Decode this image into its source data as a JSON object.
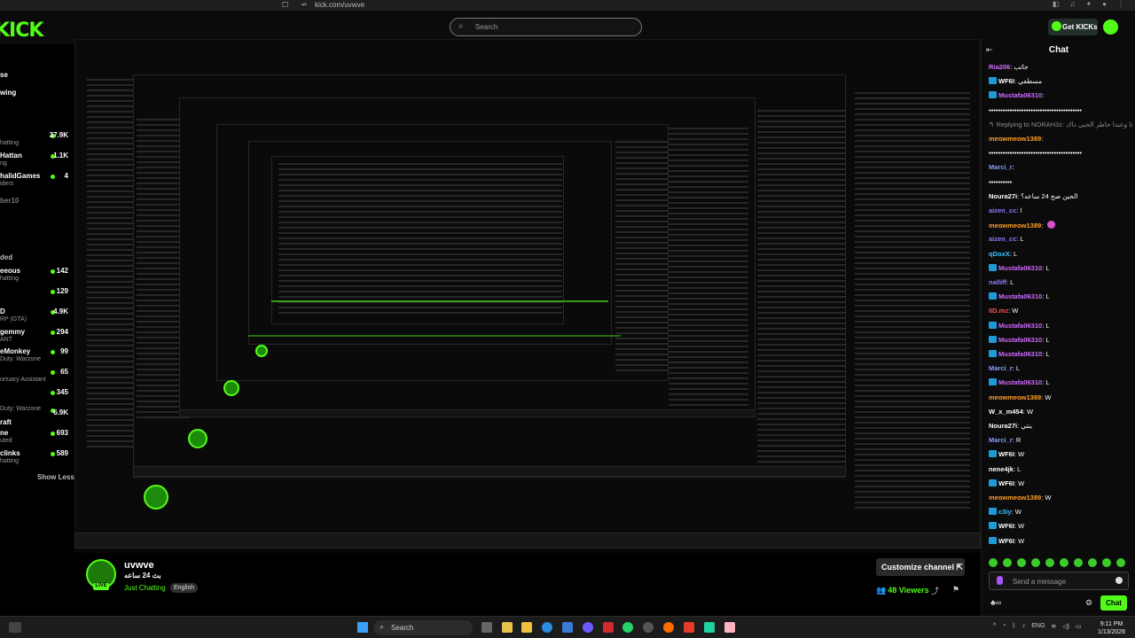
{
  "browser": {
    "url": "kick.com/uvwve"
  },
  "header": {
    "logo": "KICK",
    "search_placeholder": "Search",
    "get_kicks": "Get KICKs"
  },
  "sidebar": {
    "nav": [
      "se",
      "wing"
    ],
    "following": [
      {
        "name": "",
        "sub": "hatting",
        "viewers": "37.9K"
      },
      {
        "name": "Hattan",
        "sub": "ng",
        "viewers": "1.1K"
      },
      {
        "name": "halidGames",
        "sub": "iders",
        "viewers": "4"
      },
      {
        "name": "ber10",
        "sub": "",
        "viewers": ""
      }
    ],
    "recommended_label": "ded",
    "recommended": [
      {
        "name": "eeous",
        "sub": "hatting",
        "viewers": "142"
      },
      {
        "name": "",
        "sub": "",
        "viewers": "129"
      },
      {
        "name": "D",
        "sub": "RP (GTA)",
        "viewers": "4.9K"
      },
      {
        "name": "gemmy",
        "sub": "ANT",
        "viewers": "294"
      },
      {
        "name": "eMonkey",
        "sub": "Duty: Warzone",
        "viewers": "99"
      },
      {
        "name": "",
        "sub": "ortuary Assistant",
        "viewers": "65"
      },
      {
        "name": "",
        "sub": "",
        "viewers": "345"
      },
      {
        "name": "",
        "sub": "Duty: Warzone",
        "viewers": "6.9K"
      },
      {
        "name": "raft",
        "sub": "",
        "viewers": ""
      },
      {
        "name": "ne",
        "sub": "uted",
        "viewers": "693"
      },
      {
        "name": "clinks",
        "sub": "hatting",
        "viewers": "589"
      }
    ],
    "show_less": "Show Less"
  },
  "stream": {
    "name": "uvwve",
    "title": "بث 24 ساعه",
    "category": "Just Chatting",
    "language": "English",
    "live": "LIVE",
    "customize": "Customize channel",
    "viewers": "48 Viewers"
  },
  "chat": {
    "title": "Chat",
    "messages": [
      {
        "user": "Ria206",
        "text": "جاتب",
        "color": "#d56cff",
        "badge": false
      },
      {
        "user": "WF6I",
        "text": "مسطفي",
        "color": "#ffffff",
        "badge": true
      },
      {
        "user": "Mustafa06310",
        "text": "",
        "color": "#cf6bff",
        "badge": true
      },
      {
        "user": "",
        "text": "••••••••••••••••••••••••••••••••••••••••",
        "color": "#fff",
        "badge": false
      },
      {
        "user": "",
        "text": "↰ Replying to NORAH3z: راعيت لولاقا وعندا خاطر الحبي داك",
        "color": "#8c8c8c",
        "badge": false
      },
      {
        "user": "meowmeow1389",
        "text": "",
        "color": "#ff9e2c",
        "badge": false
      },
      {
        "user": "",
        "text": "••••••••••••••••••••••••••••••••••••••••",
        "color": "#fff",
        "badge": false
      },
      {
        "user": "Marci_r",
        "text": "",
        "color": "#7fa0ff",
        "badge": false
      },
      {
        "user": "",
        "text": "••••••••••",
        "color": "#fff",
        "badge": false
      },
      {
        "user": "Noura27i",
        "text": "الحين صح 24 ساعه؟",
        "color": "#ffffff",
        "badge": false
      },
      {
        "user": "aizen_cc",
        "text": "l",
        "color": "#8a78ff",
        "badge": false
      },
      {
        "user": "meowmeow1389",
        "text": "",
        "color": "#ff9e2c",
        "badge": false,
        "emote": true
      },
      {
        "user": "aizen_cc",
        "text": "L",
        "color": "#8a78ff",
        "badge": false
      },
      {
        "user": "qDoxX",
        "text": "L",
        "color": "#3bc3ff",
        "badge": false
      },
      {
        "user": "Mustafa06310",
        "text": "L",
        "color": "#cf6bff",
        "badge": true
      },
      {
        "user": "nalliff",
        "text": "L",
        "color": "#8f7cff",
        "badge": false
      },
      {
        "user": "Mustafa06310",
        "text": "L",
        "color": "#cf6bff",
        "badge": true
      },
      {
        "user": "0D.mz",
        "text": "W",
        "color": "#ff4d4d",
        "badge": false
      },
      {
        "user": "Mustafa06310",
        "text": "L",
        "color": "#cf6bff",
        "badge": true
      },
      {
        "user": "Mustafa06310",
        "text": "L",
        "color": "#cf6bff",
        "badge": true
      },
      {
        "user": "Mustafa06310",
        "text": "L",
        "color": "#cf6bff",
        "badge": true
      },
      {
        "user": "Marci_r",
        "text": "L",
        "color": "#7fa0ff",
        "badge": false
      },
      {
        "user": "Mustafa06310",
        "text": "L",
        "color": "#cf6bff",
        "badge": true
      },
      {
        "user": "meowmeow1389",
        "text": "W",
        "color": "#ff9e2c",
        "badge": false
      },
      {
        "user": "W_x_m454",
        "text": "W",
        "color": "#ffffff",
        "badge": false
      },
      {
        "user": "Noura27i",
        "text": "بنتي",
        "color": "#ffffff",
        "badge": false
      },
      {
        "user": "Marci_r",
        "text": "R",
        "color": "#7fa0ff",
        "badge": false
      },
      {
        "user": "WF6I",
        "text": "W",
        "color": "#ffffff",
        "badge": true
      },
      {
        "user": "nene4jk",
        "text": "L",
        "color": "#ffffff",
        "badge": false
      },
      {
        "user": "WF6I",
        "text": "W",
        "color": "#ffffff",
        "badge": true
      },
      {
        "user": "meowmeow1389",
        "text": "W",
        "color": "#ff9e2c",
        "badge": false
      },
      {
        "user": "c3iy",
        "text": "W",
        "color": "#3bc3ff",
        "badge": true
      },
      {
        "user": "WF6I",
        "text": "W",
        "color": "#ffffff",
        "badge": true
      },
      {
        "user": "WF6I",
        "text": "W",
        "color": "#ffffff",
        "badge": true
      }
    ],
    "input_placeholder": "Send a message",
    "send": "Chat"
  },
  "taskbar": {
    "search": "Search",
    "lang": "ENG",
    "time": "9:11 PM",
    "date": "1/13/2026"
  },
  "colors": {
    "accent": "#53fc18",
    "bg": "#000000"
  }
}
